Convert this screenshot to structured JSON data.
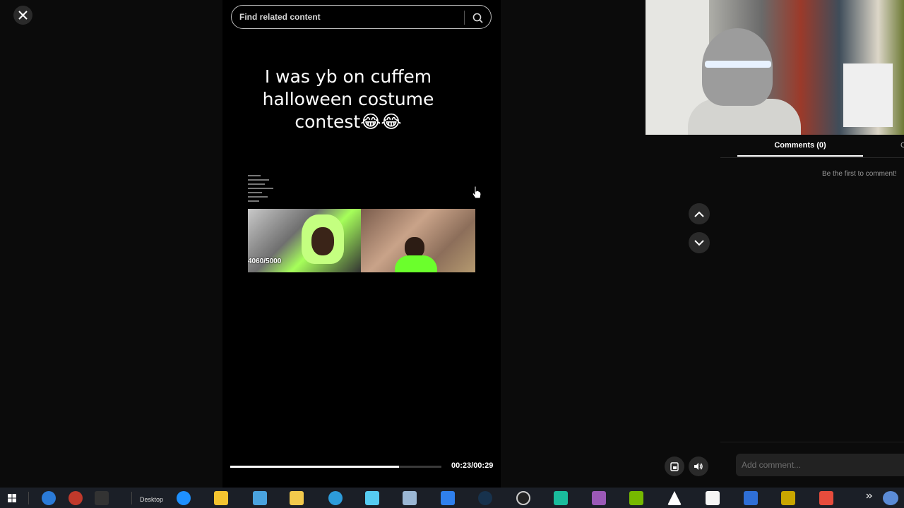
{
  "search": {
    "placeholder": "Find related content"
  },
  "video": {
    "caption_lines": [
      "I was yb on cuffem",
      "halloween costume",
      "contest😂😂"
    ],
    "overlay_counter": "4060/5000",
    "time": "00:23/00:29",
    "progress": 0.8
  },
  "comments": {
    "tab_label": "Comments (0)",
    "tab_cut": "C",
    "empty_text": "Be the first to comment!",
    "input_placeholder": "Add comment..."
  },
  "taskbar": {
    "desktop_label": "Desktop"
  },
  "colors": {
    "bg": "#0b0b0b",
    "player_bg": "#000000",
    "accent": "#ffffff"
  }
}
